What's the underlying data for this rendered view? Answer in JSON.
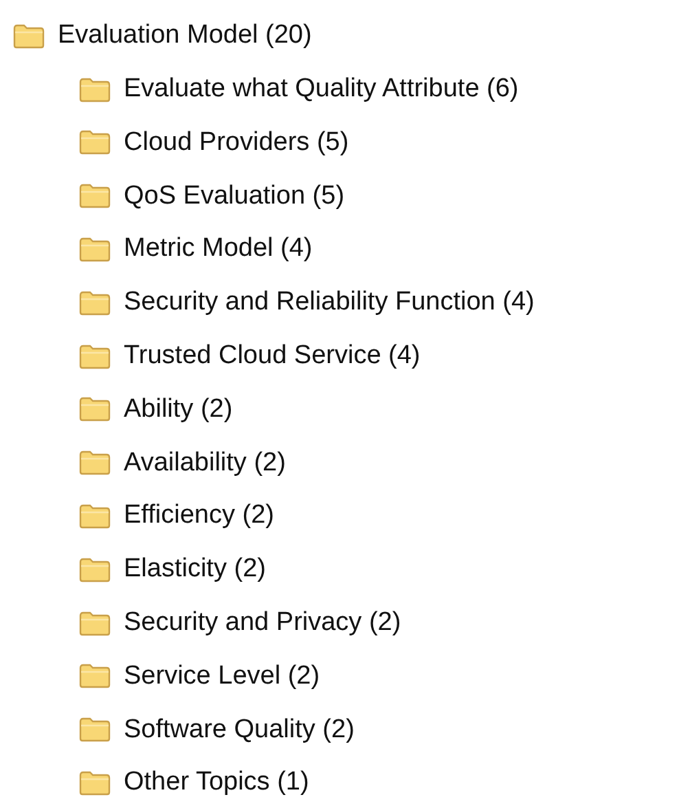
{
  "tree": [
    {
      "label": "Evaluation Model (20)",
      "children": [
        {
          "label": "Evaluate what Quality Attribute (6)"
        },
        {
          "label": "Cloud Providers (5)"
        },
        {
          "label": "QoS Evaluation (5)"
        },
        {
          "label": "Metric Model (4)"
        },
        {
          "label": "Security and Reliability Function (4)"
        },
        {
          "label": "Trusted Cloud Service (4)"
        },
        {
          "label": "Ability (2)"
        },
        {
          "label": "Availability (2)"
        },
        {
          "label": "Efficiency (2)"
        },
        {
          "label": "Elasticity (2)"
        },
        {
          "label": "Security and Privacy (2)"
        },
        {
          "label": "Service Level (2)"
        },
        {
          "label": "Software Quality (2)"
        },
        {
          "label": "Other Topics (1)"
        }
      ]
    }
  ]
}
